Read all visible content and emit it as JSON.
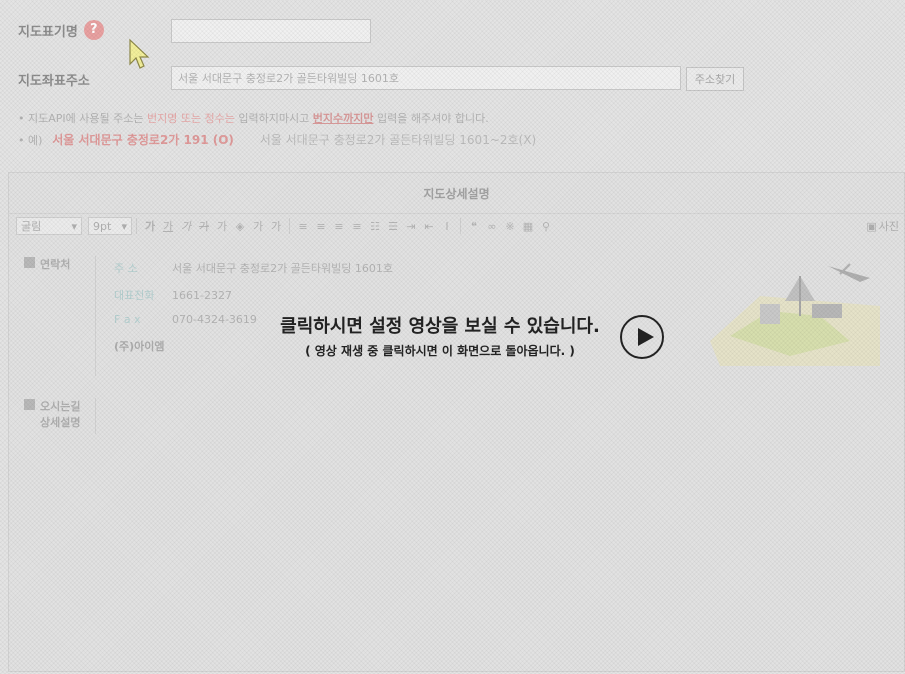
{
  "form": {
    "map_name_label": "지도표기명",
    "map_name_value": "",
    "help_icon": "?",
    "map_addr_label": "지도좌표주소",
    "map_addr_value": "서울 서대문구 충정로2가 골든타워빌딩 1601호",
    "find_addr_button": "주소찾기"
  },
  "notes": {
    "line1_prefix": "• 지도API에 사용될 주소는 ",
    "line1_red": "번지명 또는 정수는",
    "line1_mid": " 입력하지마시고 ",
    "line1_emph": "번지수까지만",
    "line1_suffix": " 입력을 해주셔야 합니다.",
    "example_label": "• 예)",
    "example_good": "서울 서대문구 충정로2가 191 (O)",
    "example_bad": "서울 서대문구 충정로2가 골든타워빌딩 1601~2호(X)"
  },
  "panel": {
    "title": "지도상세설명",
    "toolbar": {
      "font_select": "굴림",
      "size_select": "9pt",
      "buttons": [
        "가",
        "가",
        "가",
        "가",
        "가",
        "가",
        "가",
        "가"
      ],
      "photo_button": "사진"
    }
  },
  "contact": {
    "section_label": "연락처",
    "addr_key": "주  소",
    "addr_value": "서울 서대문구 충정로2가 골든타워빌딩 1601호",
    "tel_key": "대표전화",
    "tel_value": "1661-2327",
    "fax_key": "F  a  x",
    "fax_value": "070-4324-3619",
    "company": "(주)아이엠"
  },
  "directions": {
    "label_line1": "오시는길",
    "label_line2": "상세설명"
  },
  "video": {
    "message": "클릭하시면 설정 영상을 보실 수 있습니다.",
    "sub_message": "( 영상 재생 중 클릭하시면 이 화면으로 돌아옵니다. )",
    "play_icon": "play-icon"
  },
  "colors": {
    "accent_red": "#e6a8a8",
    "overlay_text": "#222222"
  }
}
